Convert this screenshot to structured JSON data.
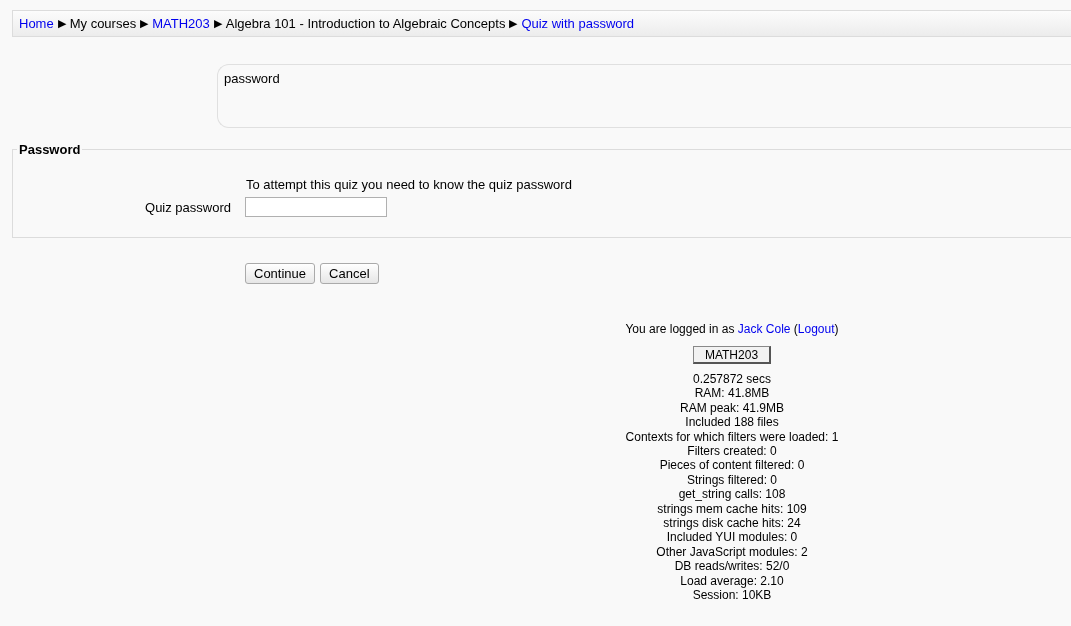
{
  "breadcrumb": {
    "separator": "▶",
    "items": [
      {
        "label": "Home",
        "link": true
      },
      {
        "label": "My courses",
        "link": false
      },
      {
        "label": "MATH203",
        "link": true
      },
      {
        "label": "Algebra 101 - Introduction to Algebraic Concepts",
        "link": false
      },
      {
        "label": "Quiz with password",
        "link": true
      }
    ]
  },
  "intro": "password",
  "form": {
    "legend": "Password",
    "notice": "To attempt this quiz you need to know the quiz password",
    "field_label": "Quiz password"
  },
  "buttons": [
    "Continue",
    "Cancel"
  ],
  "footer": {
    "login": [
      {
        "text": "You are logged in as ",
        "link": false
      },
      {
        "text": "Jack Cole",
        "link": true
      },
      {
        "text": " (",
        "link": false
      },
      {
        "text": "Logout",
        "link": true
      },
      {
        "text": ")",
        "link": false
      }
    ],
    "home_button": "MATH203",
    "stats": [
      "0.257872 secs",
      "RAM: 41.8MB",
      "RAM peak: 41.9MB",
      "Included 188 files",
      "Contexts for which filters were loaded: 1",
      "Filters created: 0",
      "Pieces of content filtered: 0",
      "Strings filtered: 0",
      "get_string calls: 108",
      "strings mem cache hits: 109",
      "strings disk cache hits: 24",
      "Included YUI modules: 0",
      "Other JavaScript modules: 2",
      "DB reads/writes: 52/0",
      "Load average: 2.10",
      "Session: 10KB"
    ]
  }
}
